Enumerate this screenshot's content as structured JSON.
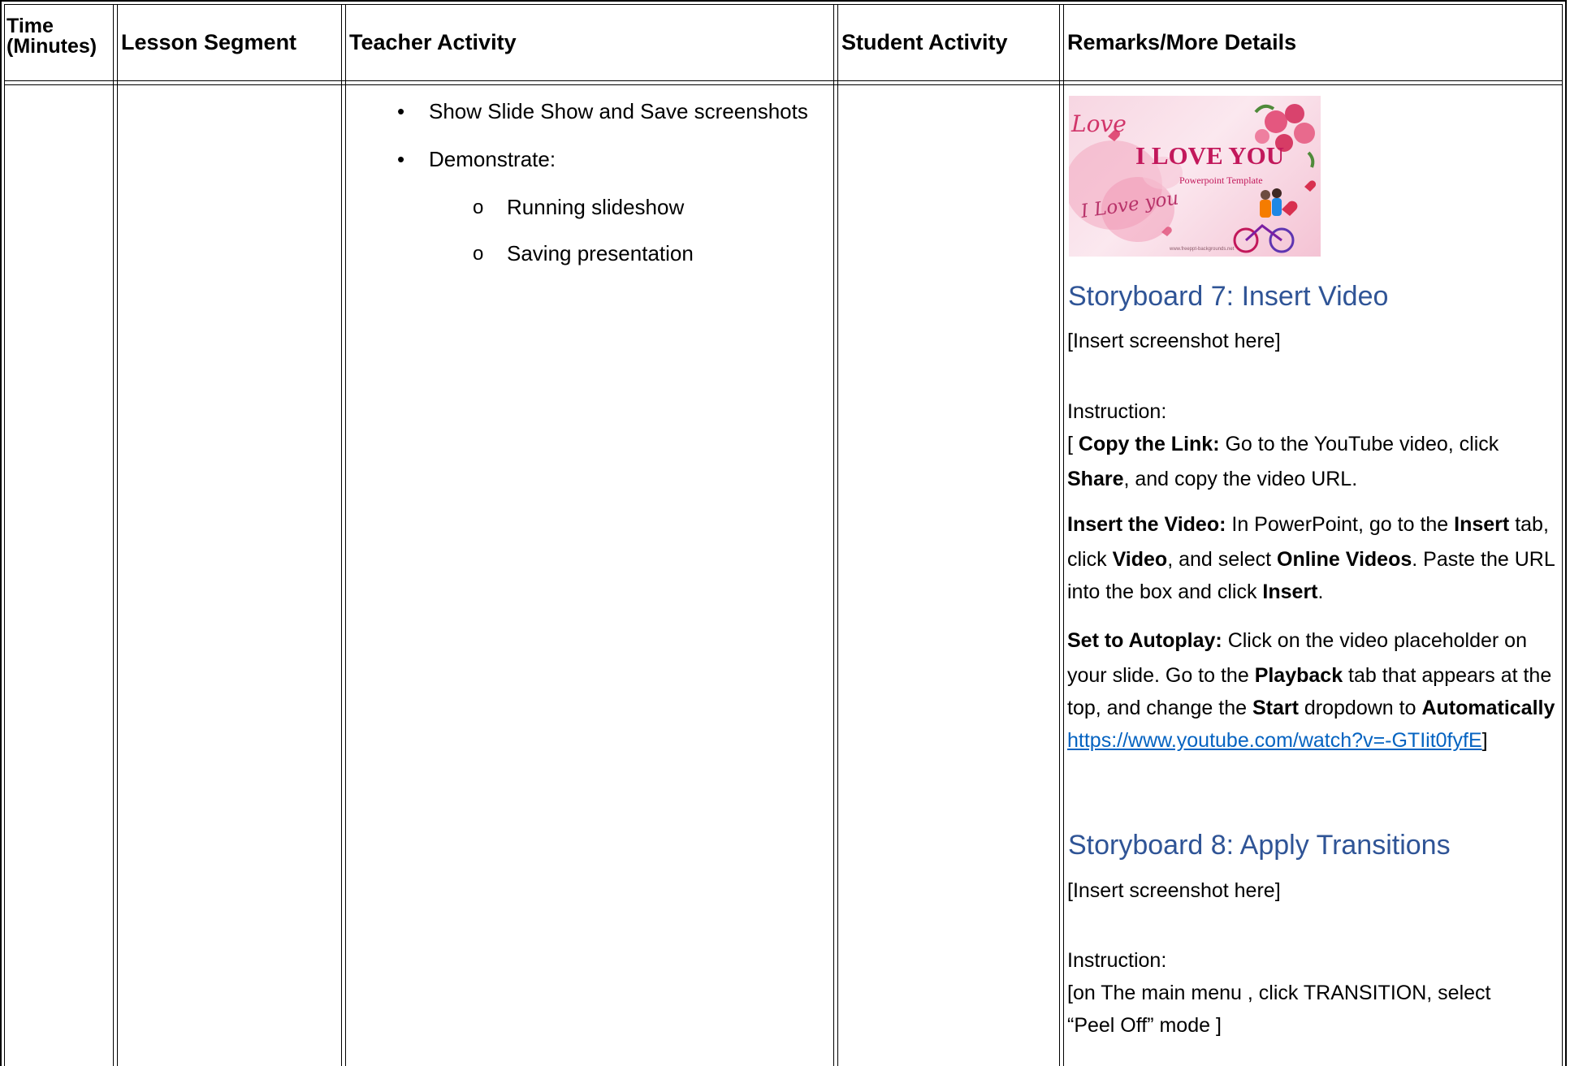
{
  "table": {
    "headers": {
      "time_line1": "Time",
      "time_line2": "(Minutes)",
      "lesson_segment": "Lesson Segment",
      "teacher_activity": "Teacher Activity",
      "student_activity": "Student Activity",
      "remarks": "Remarks/More Details"
    },
    "teacher": {
      "bullets": [
        "Show Slide Show and Save screenshots",
        "Demonstrate:"
      ],
      "sub_bullets": [
        "Running slideshow",
        "Saving presentation"
      ],
      "bullet_glyph": "•",
      "sub_bullet_glyph": "o"
    },
    "remarks": {
      "image": {
        "love_script": "Love",
        "title": "I LOVE YOU",
        "subtitle": "Powerpoint Template",
        "signature": "I Love you",
        "footer": "www.freeppt-backgrounds.net"
      },
      "storyboard7": {
        "title": "Storyboard 7: Insert Video",
        "placeholder": "[Insert screenshot here]",
        "instruction_label": "Instruction:",
        "glyph": "",
        "step1_prefix": "[ ",
        "step1_bold": "Copy the Link:",
        "step1_text_a": " Go to the YouTube video, click ",
        "step1_share": "Share",
        "step1_text_b": ", and copy the video URL.",
        "step2_bold": "Insert the Video:",
        "step2_text_a": " In PowerPoint, go to the ",
        "step2_insert": "Insert",
        "step2_text_b": " tab, click ",
        "step2_video": "Video",
        "step2_text_c": ", and select ",
        "step2_online": "Online Videos",
        "step2_text_d": ". Paste the URL into the box and click ",
        "step2_insert2": "Insert",
        "step2_text_e": ".",
        "step3_bold": "Set to Autoplay:",
        "step3_text_a": " Click on the video placeholder on your slide. Go to the ",
        "step3_playback": "Playback",
        "step3_text_b": " tab that appears at the top, and change the ",
        "step3_start": "Start",
        "step3_text_c": " dropdown to ",
        "step3_auto": "Automatically",
        "link": "https://www.youtube.com/watch?v=-GTIit0fyfE",
        "close_bracket": "]"
      },
      "storyboard8": {
        "title": "Storyboard 8: Apply Transitions",
        "placeholder": "[Insert screenshot here]",
        "instruction_label": "Instruction:",
        "text": "[on The main menu , click TRANSITION, select “Peel Off” mode ]"
      }
    }
  },
  "colors": {
    "storyboard_title": "#2f5496",
    "link": "#0563c1",
    "border": "#000000"
  }
}
